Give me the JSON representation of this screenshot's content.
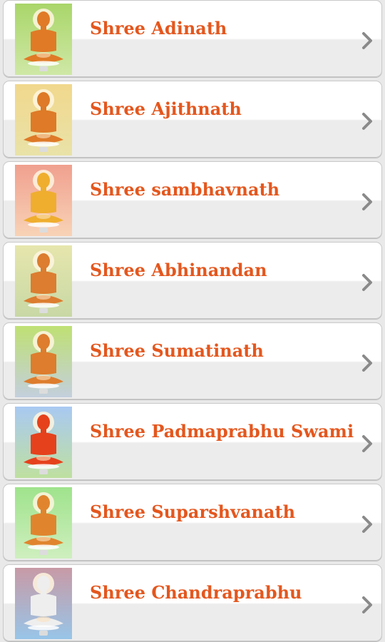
{
  "items": [
    {
      "label": "Shree Adinath",
      "bg_top": "#a9d66a",
      "bg_bottom": "#cfe8a6",
      "figure": "#e07a26"
    },
    {
      "label": "Shree Ajithnath",
      "bg_top": "#f1d88d",
      "bg_bottom": "#e9e2a8",
      "figure": "#de7a28"
    },
    {
      "label": "Shree sambhavnath",
      "bg_top": "#f0a08f",
      "bg_bottom": "#f8d3b6",
      "figure": "#efae2e"
    },
    {
      "label": "Shree Abhinandan",
      "bg_top": "#e6e6ad",
      "bg_bottom": "#c8d8a5",
      "figure": "#dc7d30"
    },
    {
      "label": "Shree Sumatinath",
      "bg_top": "#bfe073",
      "bg_bottom": "#c3cfdd",
      "figure": "#dd7d2d"
    },
    {
      "label": "Shree Padmaprabhu Swami",
      "bg_top": "#a9c9f2",
      "bg_bottom": "#bfe0a0",
      "figure": "#e5411c"
    },
    {
      "label": "Shree Suparshvanath",
      "bg_top": "#9fe38c",
      "bg_bottom": "#cfefbf",
      "figure": "#e0852e"
    },
    {
      "label": "Shree Chandraprabhu",
      "bg_top": "#c89aa6",
      "bg_bottom": "#98c5e8",
      "figure": "#eeeeee"
    }
  ],
  "colors": {
    "label_text": "#e4571e",
    "chevron": "#8a8a8a"
  },
  "icons": {
    "thumbnail": "tirthankar-idol-icon",
    "row_arrow": "chevron-right-icon"
  }
}
